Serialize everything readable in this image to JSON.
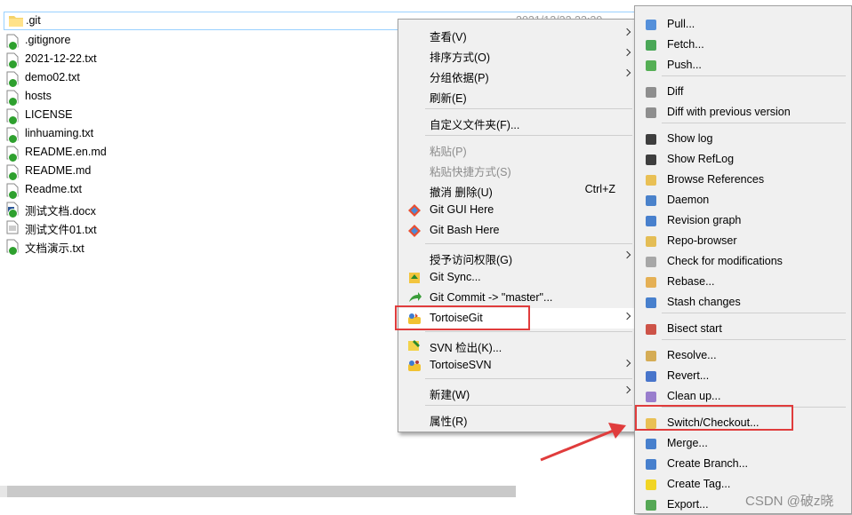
{
  "files": [
    {
      "name": ".git",
      "date": "2021/12/22 23:29",
      "icon": "folder-icon",
      "badge": false
    },
    {
      "name": ".gitignore",
      "icon": "file-icon",
      "badge": true
    },
    {
      "name": "2021-12-22.txt",
      "icon": "file-icon",
      "badge": true
    },
    {
      "name": "demo02.txt",
      "icon": "file-icon",
      "badge": true
    },
    {
      "name": "hosts",
      "icon": "file-icon",
      "badge": true
    },
    {
      "name": "LICENSE",
      "icon": "file-icon",
      "badge": true
    },
    {
      "name": "linhuaming.txt",
      "icon": "file-icon",
      "badge": true
    },
    {
      "name": "README.en.md",
      "icon": "file-icon",
      "badge": true
    },
    {
      "name": "README.md",
      "icon": "file-icon",
      "badge": true
    },
    {
      "name": "Readme.txt",
      "icon": "file-icon",
      "badge": true
    },
    {
      "name": "测试文档.docx",
      "icon": "word-doc-icon",
      "badge": true
    },
    {
      "name": "测试文件01.txt",
      "icon": "text-file-icon",
      "badge": false
    },
    {
      "name": "文档演示.txt",
      "icon": "file-icon",
      "badge": true
    }
  ],
  "context_menu": {
    "view": "查看(V)",
    "sort_by": "排序方式(O)",
    "group_by": "分组依据(P)",
    "refresh": "刷新(E)",
    "customize_folder": "自定义文件夹(F)...",
    "paste": "粘贴(P)",
    "paste_shortcut": "粘贴快捷方式(S)",
    "undo_delete": "撤消 删除(U)",
    "undo_shortcut": "Ctrl+Z",
    "git_gui_here": "Git GUI Here",
    "git_bash_here": "Git Bash Here",
    "grant_access": "授予访问权限(G)",
    "git_sync": "Git Sync...",
    "git_commit": "Git Commit -> \"master\"...",
    "tortoisegit": "TortoiseGit",
    "svn_checkout": "SVN 检出(K)...",
    "tortoisesvn": "TortoiseSVN",
    "new": "新建(W)",
    "properties": "属性(R)"
  },
  "tortoisegit_menu": {
    "pull": "Pull...",
    "fetch": "Fetch...",
    "push": "Push...",
    "diff": "Diff",
    "diff_prev": "Diff with previous version",
    "show_log": "Show log",
    "show_reflog": "Show RefLog",
    "browse_refs": "Browse References",
    "daemon": "Daemon",
    "revision_graph": "Revision graph",
    "repo_browser": "Repo-browser",
    "check_mods": "Check for modifications",
    "rebase": "Rebase...",
    "stash": "Stash changes",
    "bisect": "Bisect start",
    "resolve": "Resolve...",
    "revert": "Revert...",
    "cleanup": "Clean up...",
    "switch_checkout": "Switch/Checkout...",
    "merge": "Merge...",
    "create_branch": "Create Branch...",
    "create_tag": "Create Tag...",
    "export": "Export..."
  },
  "watermark": "CSDN @破z晓",
  "colors": {
    "highlight_box": "#e03c3c",
    "annotation_arrow": "#e03c3c",
    "menu_bg": "#f0f0f0"
  }
}
